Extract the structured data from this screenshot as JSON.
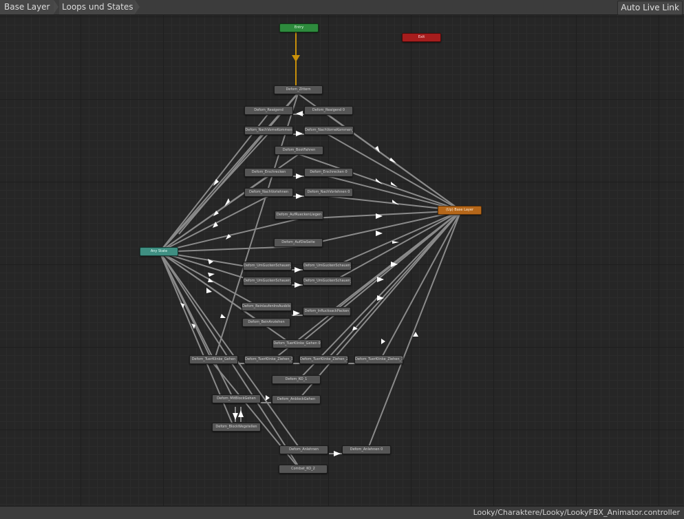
{
  "breadcrumb": {
    "items": [
      "Base Layer",
      "Loops und States"
    ]
  },
  "toolbar": {
    "live_link_label": "Auto Live Link"
  },
  "footer": {
    "controller_path": "Looky/Charaktere/Looky/LookyFBX_Animator.controller"
  },
  "colors": {
    "entry": "#2e8b3d",
    "exit": "#a61d1d",
    "any_state": "#3f8f82",
    "up_base_layer": "#b5671a",
    "state": "#555555",
    "transition": "#8a8a8a",
    "entry_transition": "#c8900a"
  },
  "states": {
    "entry": "Entry",
    "exit": "Exit",
    "any_state": "Any State",
    "up_base_layer": "(Up) Base Layer",
    "zitter": "Defom_Zittern",
    "reaigend": "Defom_Reaigend",
    "reaigend0": "Defom_Reaigend 0",
    "nachvornekommen": "Defom_NachVorneKommen",
    "nachvornekommen_einzeln": "Defom_NachVorneKommen_Einzeln",
    "bootfahren": "Defom_BootFahren",
    "erschreiben": "Defom_Erschrecken",
    "erschreiben0": "Defom_Erschrecken 0",
    "nachvorlehnen": "Defom_NachVorlehnen",
    "nachvorlehnen0": "Defom_NachVorlehnen 0",
    "aufrueckenliegen": "Defom_AufRueckenLiegen",
    "aufdieseite": "Defom_AufDieSeite",
    "umgucken_l": "Defom_UmGuckenSchauen_L",
    "umgucken_l0": "Defom_UmGuckenSchauen_L 0",
    "umgucken_r": "Defom_UmGuckenSchauen_R",
    "umgucken_r0": "Defom_UmGuckenSchauen_R 0",
    "reinlaufen": "Defom_ReinlaufenInsAusblicken",
    "insrucksack": "Defom_InRucksackPacken",
    "beinanziehen": "Defom_BeinAnziehen",
    "tuer_gehen0": "Defom_TuerKlinke_Gehen 0",
    "tuer_gehen": "Defom_TuerKlinke_Gehen",
    "tuer_ziehen1": "Defom_TuerKlinke_Ziehen_1",
    "tuer_ziehen2": "Defom_TuerKlinke_Ziehen_2",
    "tuer_ziehen3": "Defom_TuerKlinke_Ziehen_3",
    "ko1": "Defom_KO_1",
    "mitblock": "Defom_MitBlockGehen",
    "anblock": "Defom_AnblockGehen",
    "blockwegstellen": "Defom_BlockWegstellen",
    "anlehnen": "Defom_Anlehnen",
    "anlehnen0": "Defom_Anlehnen 0",
    "combat_ko2": "Combat_KO_2"
  }
}
